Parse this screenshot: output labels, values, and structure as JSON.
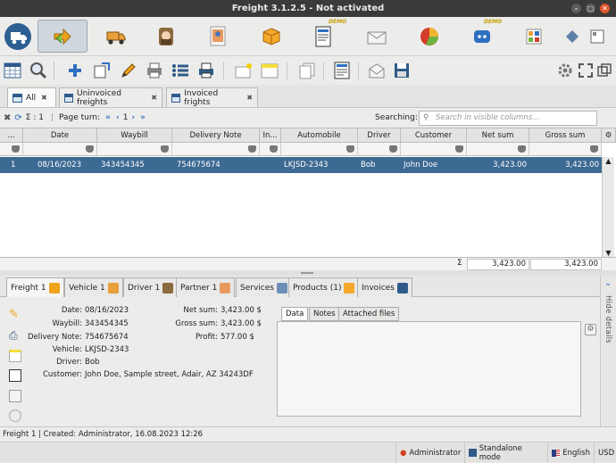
{
  "window": {
    "title": "Freight 3.1.2.5 - Not activated",
    "close": "✕"
  },
  "nav": {
    "items": [
      {
        "name": "nav-freights",
        "icon": "arrow-exchange-icon",
        "active": true
      },
      {
        "name": "nav-vehicles",
        "icon": "truck-icon"
      },
      {
        "name": "nav-drivers",
        "icon": "driver-icon"
      },
      {
        "name": "nav-partners",
        "icon": "contact-card-icon"
      },
      {
        "name": "nav-products",
        "icon": "box-icon"
      },
      {
        "name": "nav-invoices",
        "icon": "invoice-icon",
        "demo": "DEMO"
      },
      {
        "name": "nav-mail",
        "icon": "envelope-icon"
      },
      {
        "name": "nav-statistics",
        "icon": "pie-chart-icon"
      },
      {
        "name": "nav-backup",
        "icon": "cloud-icon",
        "demo": "DEMO"
      },
      {
        "name": "nav-apps",
        "icon": "grid-icon"
      }
    ]
  },
  "tabs": [
    {
      "label": "All",
      "close": "✖"
    },
    {
      "label": "Uninvoiced freights",
      "close": "✖"
    },
    {
      "label": "Invoiced frights",
      "close": "✖"
    }
  ],
  "pager": {
    "count": "Σ : 1",
    "page_turn": "Page turn:",
    "page": "1",
    "searching": "Searching:",
    "search_placeholder": "Search in visible columns..."
  },
  "table": {
    "columns": [
      "...",
      "Date",
      "Waybill",
      "Delivery Note",
      "In...",
      "Automobile",
      "Driver",
      "Customer",
      "Net sum",
      "Gross sum"
    ],
    "rows": [
      [
        "1",
        "08/16/2023",
        "343454345",
        "754675674",
        "",
        "LKJSD-2343",
        "Bob",
        "John Doe",
        "3,423.00",
        "3,423.00"
      ]
    ],
    "sum_symbol": "Σ",
    "net_total": "3,423.00",
    "gross_total": "3,423.00"
  },
  "detail_tabs": [
    "Freight 1",
    "Vehicle 1",
    "Driver 1",
    "Partner 1",
    "Services",
    "Products (1)",
    "Invoices"
  ],
  "detail": {
    "date_label": "Date:",
    "date": "08/16/2023",
    "waybill_label": "Waybill:",
    "waybill": "343454345",
    "delivery_label": "Delivery Note:",
    "delivery": "754675674",
    "vehicle_label": "Vehicle:",
    "vehicle": "LKJSD-2343",
    "driver_label": "Driver:",
    "driver": "Bob",
    "customer_label": "Customer:",
    "customer": "John Doe, Sample street, Adair, AZ 34243DF",
    "net_label": "Net sum:",
    "net": "3,423.00 $",
    "gross_label": "Gross sum:",
    "gross": "3,423.00 $",
    "profit_label": "Profit:",
    "profit": "577.00 $",
    "notebook_tabs": [
      "Data",
      "Notes",
      "Attached files"
    ],
    "hide_details": "Hide details"
  },
  "status": {
    "created": "Freight 1 | Created: Administrator, 16.08.2023 12:26",
    "user": "Administrator",
    "mode": "Standalone mode",
    "language": "English",
    "currency": "USD"
  },
  "colors": {
    "selection": "#3d6a93",
    "titlebar": "#3a3a38",
    "accent": "#2e6fbf"
  }
}
